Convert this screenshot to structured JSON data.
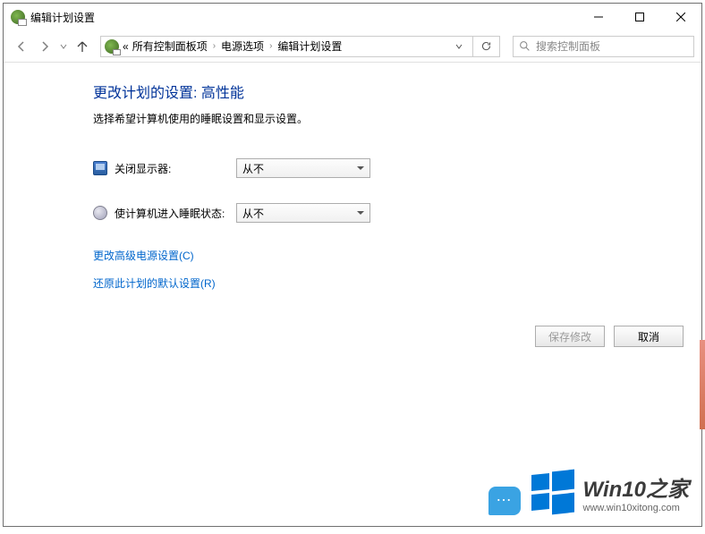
{
  "titlebar": {
    "title": "编辑计划设置"
  },
  "breadcrumb": {
    "prefix": "«",
    "items": [
      "所有控制面板项",
      "电源选项",
      "编辑计划设置"
    ]
  },
  "search": {
    "placeholder": "搜索控制面板"
  },
  "content": {
    "heading": "更改计划的设置: 高性能",
    "subtext": "选择希望计算机使用的睡眠设置和显示设置。",
    "display_label": "关闭显示器:",
    "display_value": "从不",
    "sleep_label": "使计算机进入睡眠状态:",
    "sleep_value": "从不",
    "link_advanced": "更改高级电源设置(C)",
    "link_restore": "还原此计划的默认设置(R)"
  },
  "buttons": {
    "save": "保存修改",
    "cancel": "取消"
  },
  "watermark": {
    "brand": "Win10之家",
    "url": "www.win10xitong.com"
  }
}
